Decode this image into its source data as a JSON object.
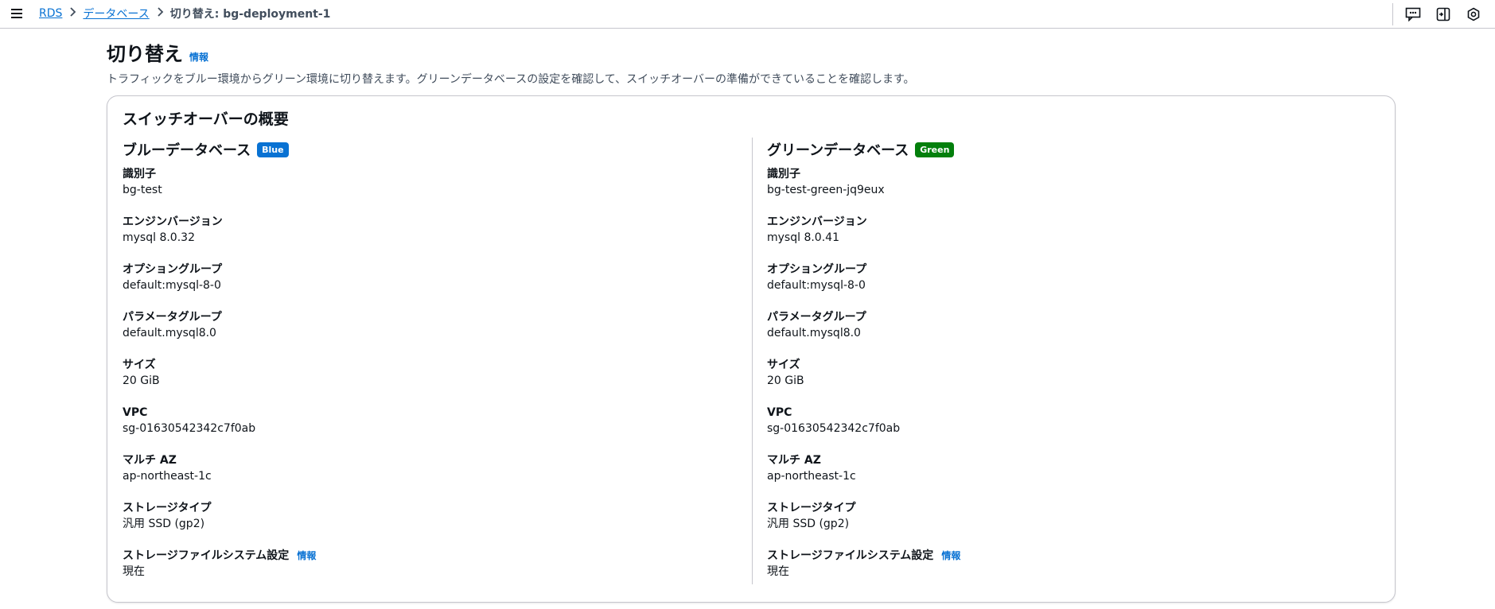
{
  "breadcrumb": {
    "items": [
      "RDS",
      "データベース"
    ],
    "current": "切り替え: bg-deployment-1"
  },
  "header": {
    "title": "切り替え",
    "info": "情報",
    "description": "トラフィックをブルー環境からグリーン環境に切り替えます。グリーンデータベースの設定を確認して、スイッチオーバーの準備ができていることを確認します。"
  },
  "summary": {
    "title": "スイッチオーバーの概要",
    "blue": {
      "heading": "ブルーデータベース",
      "badge": "Blue",
      "badge_color": "#0972d3",
      "fields": [
        {
          "label": "識別子",
          "value": "bg-test"
        },
        {
          "label": "エンジンバージョン",
          "value": "mysql 8.0.32"
        },
        {
          "label": "オプショングループ",
          "value": "default:mysql-8-0"
        },
        {
          "label": "パラメータグループ",
          "value": "default.mysql8.0"
        },
        {
          "label": "サイズ",
          "value": "20 GiB"
        },
        {
          "label": "VPC",
          "value": "sg-01630542342c7f0ab"
        },
        {
          "label": "マルチ AZ",
          "value": "ap-northeast-1c"
        },
        {
          "label": "ストレージタイプ",
          "value": "汎用 SSD (gp2)"
        },
        {
          "label": "ストレージファイルシステム設定",
          "value": "現在",
          "info": "情報"
        }
      ]
    },
    "green": {
      "heading": "グリーンデータベース",
      "badge": "Green",
      "badge_color": "#037f0c",
      "fields": [
        {
          "label": "識別子",
          "value": "bg-test-green-jq9eux"
        },
        {
          "label": "エンジンバージョン",
          "value": "mysql 8.0.41"
        },
        {
          "label": "オプショングループ",
          "value": "default:mysql-8-0"
        },
        {
          "label": "パラメータグループ",
          "value": "default.mysql8.0"
        },
        {
          "label": "サイズ",
          "value": "20 GiB"
        },
        {
          "label": "VPC",
          "value": "sg-01630542342c7f0ab"
        },
        {
          "label": "マルチ AZ",
          "value": "ap-northeast-1c"
        },
        {
          "label": "ストレージタイプ",
          "value": "汎用 SSD (gp2)"
        },
        {
          "label": "ストレージファイルシステム設定",
          "value": "現在",
          "info": "情報"
        }
      ]
    }
  },
  "topbar_icons": [
    "feedback-icon",
    "tools-panel-icon",
    "settings-icon"
  ]
}
